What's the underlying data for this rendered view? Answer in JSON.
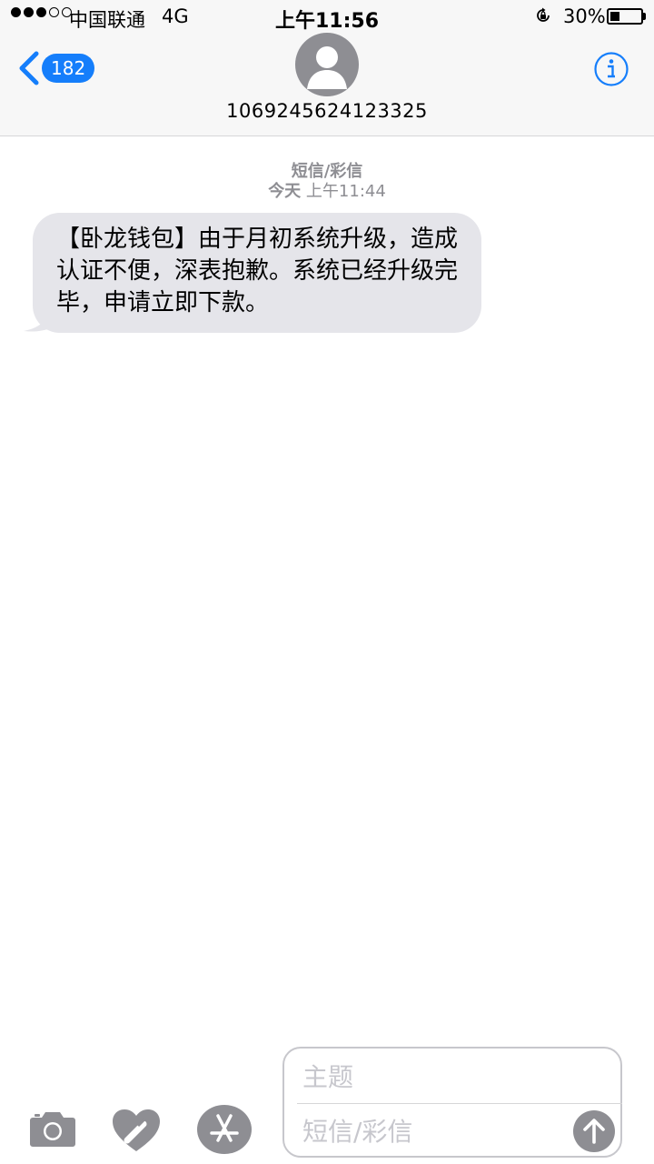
{
  "status_bar": {
    "signal_filled": 3,
    "signal_total": 5,
    "carrier": "中国联通",
    "network": "4G",
    "time": "上午11:56",
    "battery_percent_label": "30%",
    "battery_level": 0.3
  },
  "header": {
    "back_badge": "182",
    "contact_number": "1069245624123325"
  },
  "conversation": {
    "service_label": "短信/彩信",
    "timestamp_day": "今天",
    "timestamp_time": "上午11:44",
    "messages": [
      {
        "direction": "incoming",
        "text": "【卧龙钱包】由于月初系统升级，造成认证不便，深表抱歉。系统已经升级完毕，申请立即下款。"
      }
    ]
  },
  "compose": {
    "subject_placeholder": "主题",
    "message_placeholder": "短信/彩信"
  },
  "colors": {
    "accent": "#157efb",
    "bubble_incoming": "#e5e5ea",
    "secondary_text": "#8e8e93",
    "toolbar_icon": "#8e8e93"
  },
  "icons": [
    "back-chevron-icon",
    "avatar-icon",
    "info-icon",
    "camera-icon",
    "digital-touch-heart-icon",
    "app-store-icon",
    "send-arrow-icon",
    "orientation-lock-icon",
    "battery-icon"
  ]
}
